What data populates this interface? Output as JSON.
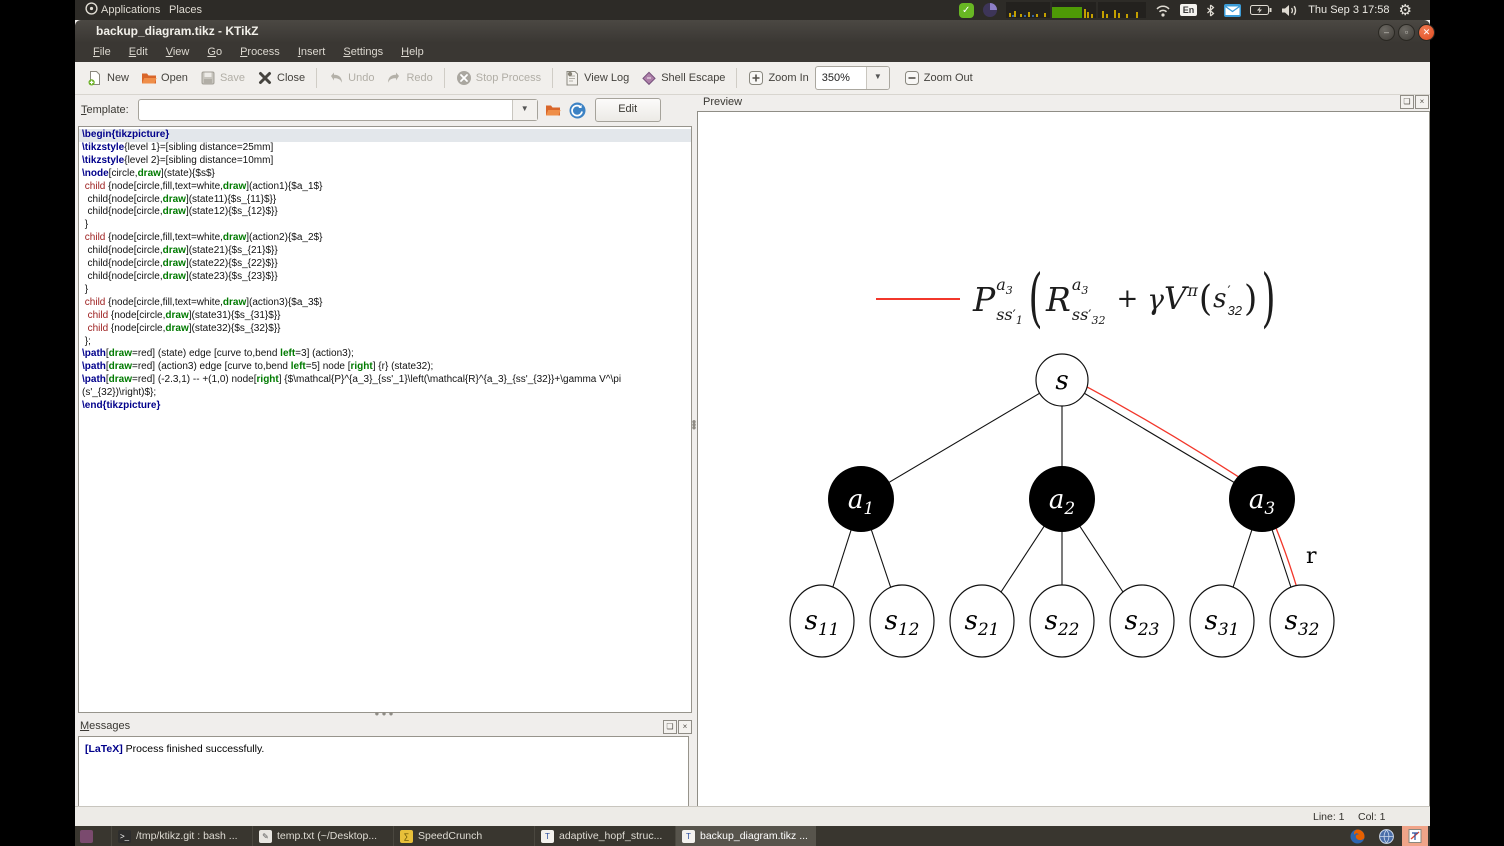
{
  "colors": {
    "accent_red": "#f2372b",
    "keyword_blue": "#00008b",
    "option_green": "#007a00",
    "child_keyword_red": "#9c1d1d",
    "panel_dark": "#2d2b27",
    "current_line": "#e3e7eb",
    "close_button_orange": "#df4b20",
    "taskbar_active": "#57544c"
  },
  "top_panel": {
    "applications": "Applications",
    "places": "Places",
    "keyboard_layout": "En",
    "clock": "Thu Sep 3 17:58"
  },
  "window": {
    "title": "backup_diagram.tikz - KTikZ",
    "menubar": [
      "File",
      "Edit",
      "View",
      "Go",
      "Process",
      "Insert",
      "Settings",
      "Help"
    ],
    "toolbar": {
      "new": "New",
      "open": "Open",
      "save": "Save",
      "close": "Close",
      "undo": "Undo",
      "redo": "Redo",
      "stop_process": "Stop Process",
      "view_log": "View Log",
      "shell_escape": "Shell Escape",
      "zoom_in": "Zoom In",
      "zoom_level": "350%",
      "zoom_out": "Zoom Out"
    },
    "template": {
      "label": "Template:",
      "value": "",
      "edit_button": "Edit"
    },
    "statusbar": {
      "line": "Line: 1",
      "col": "Col: 1"
    }
  },
  "editor": {
    "lines": [
      {
        "h": true,
        "s": [
          [
            "k",
            "\\begin{tikzpicture}"
          ]
        ]
      },
      {
        "s": [
          [
            "k",
            "\\tikzstyle"
          ],
          [
            "t",
            "{level 1}=[sibling distance=25mm]"
          ]
        ]
      },
      {
        "s": [
          [
            "k",
            "\\tikzstyle"
          ],
          [
            "t",
            "{level 2}=[sibling distance=10mm]"
          ]
        ]
      },
      {
        "s": [
          [
            "k",
            "\\node"
          ],
          [
            "t",
            "[circle,"
          ],
          [
            "o",
            "draw"
          ],
          [
            "t",
            "](state){$s$}"
          ]
        ]
      },
      {
        "s": [
          [
            "t",
            " "
          ],
          [
            "c",
            "child"
          ],
          [
            "t",
            " {node[circle,fill,text=white,"
          ],
          [
            "o",
            "draw"
          ],
          [
            "t",
            "](action1){$a_1$}"
          ]
        ]
      },
      {
        "s": [
          [
            "t",
            "  child{node[circle,"
          ],
          [
            "o",
            "draw"
          ],
          [
            "t",
            "](state11){$s_{11}$}}"
          ]
        ]
      },
      {
        "s": [
          [
            "t",
            "  child{node[circle,"
          ],
          [
            "o",
            "draw"
          ],
          [
            "t",
            "](state12){$s_{12}$}}"
          ]
        ]
      },
      {
        "s": [
          [
            "t",
            " }"
          ]
        ]
      },
      {
        "s": [
          [
            "t",
            " "
          ],
          [
            "c",
            "child"
          ],
          [
            "t",
            " {node[circle,fill,text=white,"
          ],
          [
            "o",
            "draw"
          ],
          [
            "t",
            "](action2){$a_2$}"
          ]
        ]
      },
      {
        "s": [
          [
            "t",
            "  child{node[circle,"
          ],
          [
            "o",
            "draw"
          ],
          [
            "t",
            "](state21){$s_{21}$}}"
          ]
        ]
      },
      {
        "s": [
          [
            "t",
            "  child{node[circle,"
          ],
          [
            "o",
            "draw"
          ],
          [
            "t",
            "](state22){$s_{22}$}}"
          ]
        ]
      },
      {
        "s": [
          [
            "t",
            "  child{node[circle,"
          ],
          [
            "o",
            "draw"
          ],
          [
            "t",
            "](state23){$s_{23}$}}"
          ]
        ]
      },
      {
        "s": [
          [
            "t",
            " }"
          ]
        ]
      },
      {
        "s": [
          [
            "t",
            " "
          ],
          [
            "c",
            "child"
          ],
          [
            "t",
            " {node[circle,fill,text=white,"
          ],
          [
            "o",
            "draw"
          ],
          [
            "t",
            "](action3){$a_3$}"
          ]
        ]
      },
      {
        "s": [
          [
            "t",
            "  "
          ],
          [
            "c",
            "child"
          ],
          [
            "t",
            " {node[circle,"
          ],
          [
            "o",
            "draw"
          ],
          [
            "t",
            "](state31){$s_{31}$}}"
          ]
        ]
      },
      {
        "s": [
          [
            "t",
            "  "
          ],
          [
            "c",
            "child"
          ],
          [
            "t",
            " {node[circle,"
          ],
          [
            "o",
            "draw"
          ],
          [
            "t",
            "](state32){$s_{32}$}}"
          ]
        ]
      },
      {
        "s": [
          [
            "t",
            " };"
          ]
        ]
      },
      {
        "s": [
          [
            "k",
            "\\path"
          ],
          [
            "t",
            "["
          ],
          [
            "o",
            "draw"
          ],
          [
            "t",
            "=red] (state) edge [curve to,bend "
          ],
          [
            "o",
            "left"
          ],
          [
            "t",
            "=3] (action3);"
          ]
        ]
      },
      {
        "s": [
          [
            "k",
            "\\path"
          ],
          [
            "t",
            "["
          ],
          [
            "o",
            "draw"
          ],
          [
            "t",
            "=red] (action3) edge [curve to,bend "
          ],
          [
            "o",
            "left"
          ],
          [
            "t",
            "=5] node ["
          ],
          [
            "o",
            "right"
          ],
          [
            "t",
            "] {r} (state32);"
          ]
        ]
      },
      {
        "s": [
          [
            "k",
            "\\path"
          ],
          [
            "t",
            "["
          ],
          [
            "o",
            "draw"
          ],
          [
            "t",
            "=red] (-2.3,1) -- +(1,0) node["
          ],
          [
            "o",
            "right"
          ],
          [
            "t",
            "] {$\\mathcal{P}^{a_3}_{ss'_1}\\left(\\mathcal{R}^{a_3}_{ss'_{32}}+\\gamma V^\\pi"
          ]
        ]
      },
      {
        "s": [
          [
            "t",
            "(s'_{32})\\right)$};"
          ]
        ]
      },
      {
        "s": [
          [
            "k",
            "\\end{tikzpicture}"
          ]
        ]
      }
    ]
  },
  "messages": {
    "title": "Messages",
    "tag": "[LaTeX]",
    "text": " Process finished successfully."
  },
  "preview": {
    "title": "Preview",
    "formula": {
      "P": "P",
      "P_sup_a": "a",
      "P_sup_i": "3",
      "P_sub": "ss",
      "P_prime": "′",
      "P_sub_i": "1",
      "lparen": "(",
      "R": "R",
      "R_sup_a": "a",
      "R_sup_i": "3",
      "R_sub": "ss",
      "R_prime": "′",
      "R_sub_i": "32",
      "plus": "+",
      "gamma": "γ",
      "V": "V",
      "V_sup": "π",
      "inner_lparen": "(",
      "s": "s",
      "s_prime": "′",
      "s_sub": "32",
      "inner_rparen": ")",
      "rparen": ")"
    },
    "tree": {
      "root": "s",
      "actions": [
        {
          "base": "a",
          "sub": "1"
        },
        {
          "base": "a",
          "sub": "2"
        },
        {
          "base": "a",
          "sub": "3"
        }
      ],
      "states": [
        {
          "base": "s",
          "sub": "11"
        },
        {
          "base": "s",
          "sub": "12"
        },
        {
          "base": "s",
          "sub": "21"
        },
        {
          "base": "s",
          "sub": "22"
        },
        {
          "base": "s",
          "sub": "23"
        },
        {
          "base": "s",
          "sub": "31"
        },
        {
          "base": "s",
          "sub": "32"
        }
      ],
      "reward_label": "r"
    }
  },
  "taskbar": {
    "items": [
      {
        "label": "/tmp/ktikz.git : bash ..."
      },
      {
        "label": "temp.txt (~/Desktop..."
      },
      {
        "label": "SpeedCrunch"
      },
      {
        "label": "adaptive_hopf_struc..."
      },
      {
        "label": "backup_diagram.tikz ..."
      }
    ]
  }
}
